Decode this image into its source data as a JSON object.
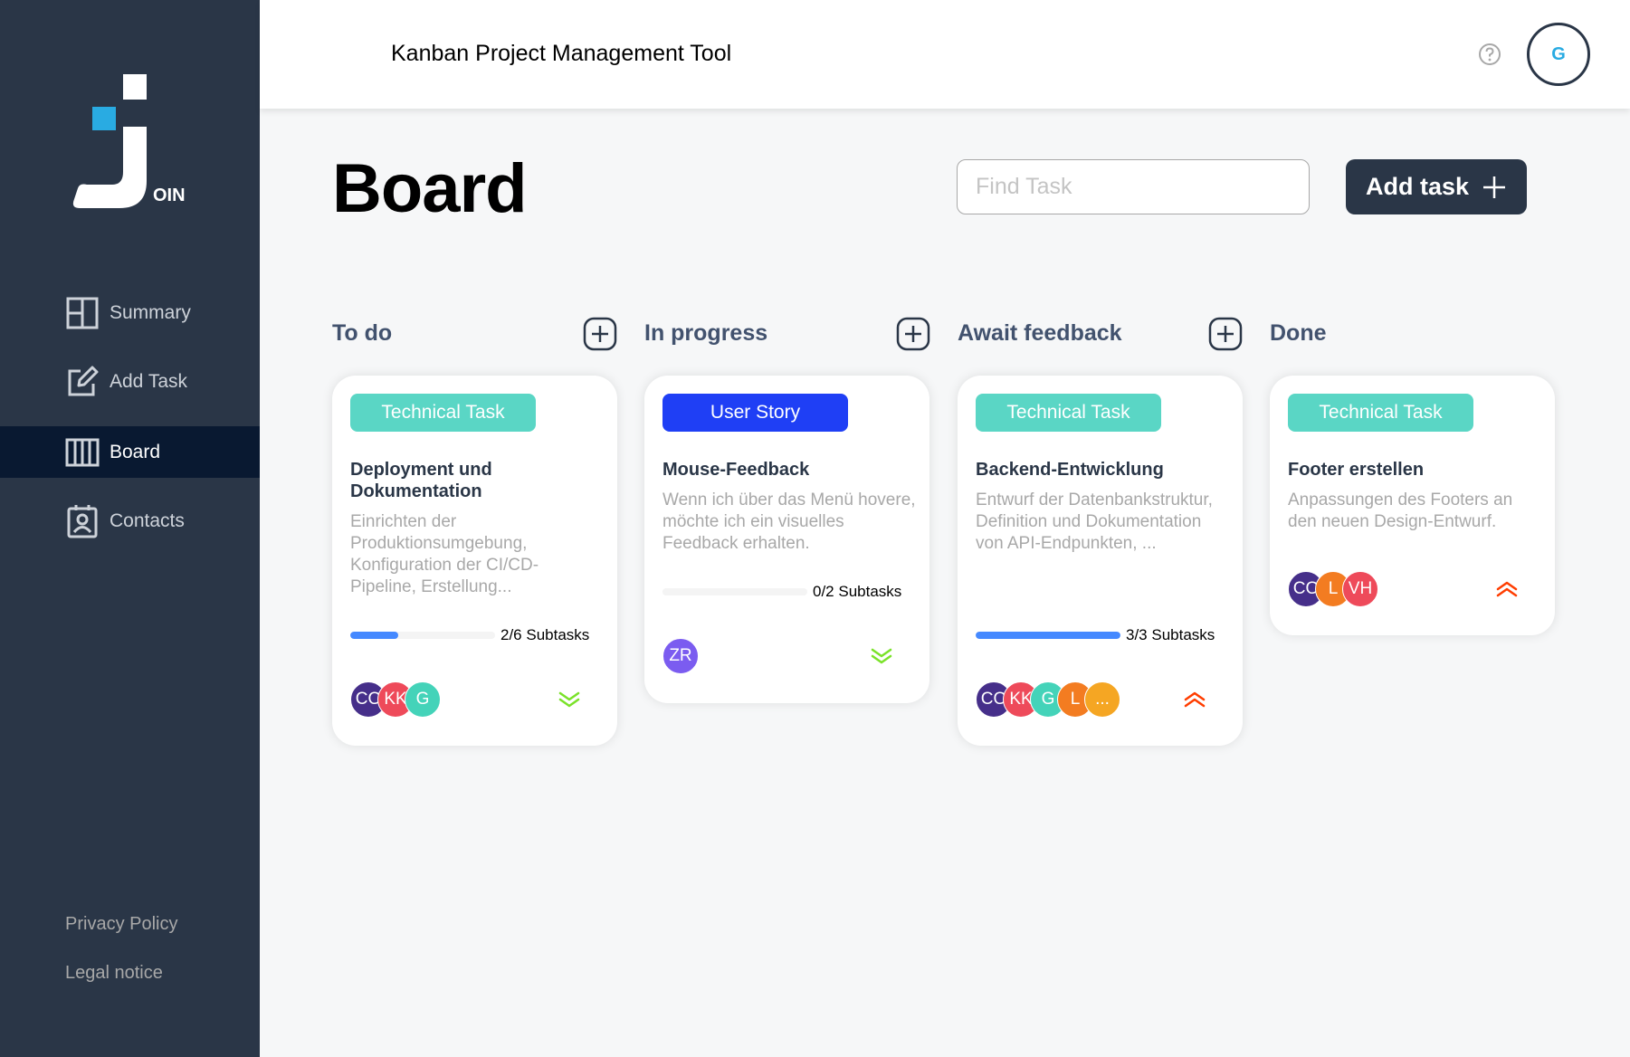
{
  "header": {
    "title": "Kanban Project Management Tool",
    "user_initial": "G"
  },
  "logo": {
    "text": "OIN"
  },
  "sidebar": {
    "items": [
      {
        "label": "Summary",
        "icon": "summary-icon"
      },
      {
        "label": "Add Task",
        "icon": "add-task-icon"
      },
      {
        "label": "Board",
        "icon": "board-icon",
        "active": true
      },
      {
        "label": "Contacts",
        "icon": "contacts-icon"
      }
    ],
    "footer": {
      "privacy": "Privacy Policy",
      "legal": "Legal notice"
    }
  },
  "page": {
    "title": "Board"
  },
  "search": {
    "placeholder": "Find Task"
  },
  "add_task_button": {
    "label": "Add task"
  },
  "colors": {
    "technical_task": "#5ad6c5",
    "user_story": "#1f3ff5",
    "prio_low": "#7ae229",
    "prio_urgent": "#ff3d00"
  },
  "columns": [
    {
      "title": "To do",
      "cards": [
        {
          "category": "Technical Task",
          "title": "Deployment und Dokumentation",
          "description": "Einrichten der Produktionsumgebung, Konfiguration der CI/CD-Pipeline, Erstellung...",
          "progress": 0.33,
          "subtasks": "2/6 Subtasks",
          "assignees": [
            {
              "initials": "CO",
              "color": "#462f8a"
            },
            {
              "initials": "KK",
              "color": "#ee4a5a"
            },
            {
              "initials": "G",
              "color": "#44d3b9"
            }
          ],
          "priority": "low"
        }
      ]
    },
    {
      "title": "In progress",
      "cards": [
        {
          "category": "User Story",
          "title": "Mouse-Feedback",
          "description": "Wenn ich über das Menü hovere, möchte ich ein visuelles Feedback erhalten.",
          "progress": 0,
          "subtasks": "0/2 Subtasks",
          "assignees": [
            {
              "initials": "ZR",
              "color": "#7b5cf0"
            }
          ],
          "priority": "low"
        }
      ]
    },
    {
      "title": "Await feedback",
      "cards": [
        {
          "category": "Technical Task",
          "title": "Backend-Entwicklung",
          "description": "Entwurf der Datenbankstruktur, Definition und Dokumentation von API-Endpunkten, ...",
          "progress": 1,
          "subtasks": "3/3 Subtasks",
          "assignees": [
            {
              "initials": "CO",
              "color": "#462f8a"
            },
            {
              "initials": "KK",
              "color": "#ee4a5a"
            },
            {
              "initials": "G",
              "color": "#44d3b9"
            },
            {
              "initials": "L",
              "color": "#f37c21"
            },
            {
              "initials": "...",
              "color": "#f5a623"
            }
          ],
          "priority": "urgent"
        }
      ]
    },
    {
      "title": "Done",
      "cards": [
        {
          "category": "Technical Task",
          "title": "Footer erstellen",
          "description": "Anpassungen des Footers an den neuen Design-Entwurf.",
          "assignees": [
            {
              "initials": "CO",
              "color": "#462f8a"
            },
            {
              "initials": "L",
              "color": "#f37c21"
            },
            {
              "initials": "VH",
              "color": "#ee4a5a"
            }
          ],
          "priority": "urgent"
        }
      ]
    }
  ]
}
